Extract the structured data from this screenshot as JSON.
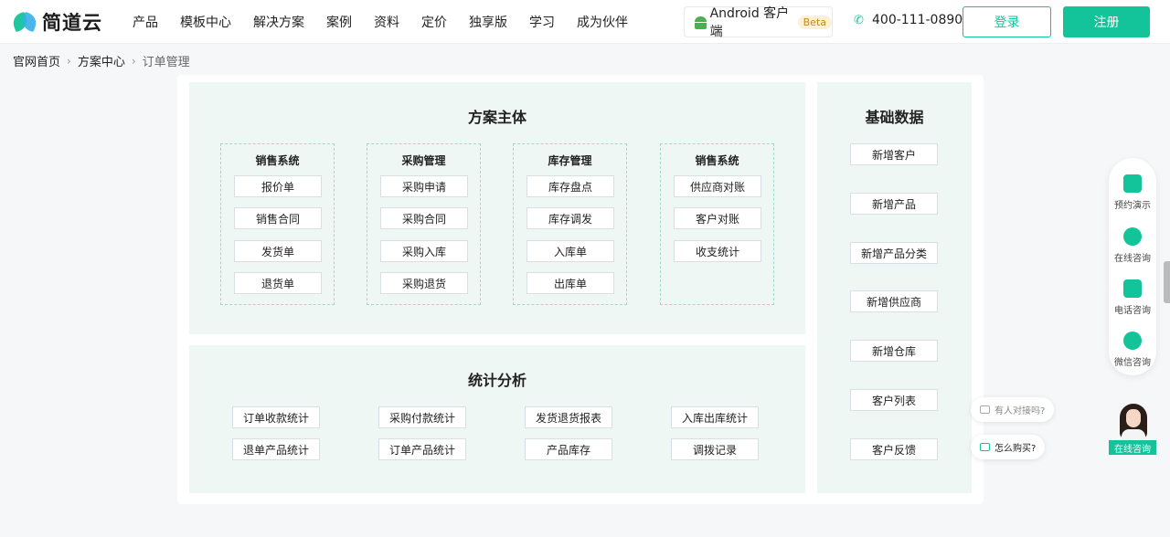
{
  "header": {
    "brand": "简道云",
    "nav": [
      "产品",
      "模板中心",
      "解决方案",
      "案例",
      "资料",
      "定价",
      "独享版",
      "学习",
      "成为伙伴"
    ],
    "android_label": "Android 客户端",
    "android_badge": "Beta",
    "phone": "400-111-0890",
    "login": "登录",
    "register": "注册"
  },
  "breadcrumb": [
    "官网首页",
    "方案中心",
    "订单管理"
  ],
  "main_panel": {
    "title": "方案主体",
    "groups": [
      {
        "title": "销售系统",
        "items": [
          "报价单",
          "销售合同",
          "发货单",
          "退货单"
        ]
      },
      {
        "title": "采购管理",
        "items": [
          "采购申请",
          "采购合同",
          "采购入库",
          "采购退货"
        ]
      },
      {
        "title": "库存管理",
        "items": [
          "库存盘点",
          "库存调发",
          "入库单",
          "出库单"
        ]
      },
      {
        "title": "销售系统",
        "items": [
          "供应商对账",
          "客户对账",
          "收支统计"
        ]
      }
    ]
  },
  "stats_panel": {
    "title": "统计分析",
    "items": [
      "订单收款统计",
      "采购付款统计",
      "发货退货报表",
      "入库出库统计",
      "退单产品统计",
      "订单产品统计",
      "产品库存",
      "调拨记录"
    ]
  },
  "base_panel": {
    "title": "基础数据",
    "items": [
      "新增客户",
      "新增产品",
      "新增产品分类",
      "新增供应商",
      "新增仓库",
      "客户列表",
      "客户反馈"
    ]
  },
  "side_tools": [
    "预约演示",
    "在线咨询",
    "电话咨询",
    "微信咨询"
  ],
  "bubbles": [
    "有人对接吗?",
    "怎么购买?"
  ],
  "agent_label": "在线咨询",
  "colors": {
    "accent": "#13c39a",
    "panel_bg": "#eff7f5",
    "dashed_border": "#9fdcc9"
  }
}
